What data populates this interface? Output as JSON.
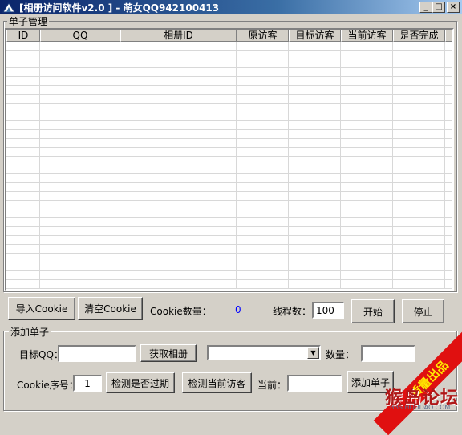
{
  "window": {
    "title": "[相册访问软件v2.0 ] - 萌女QQ942100413",
    "minimize": "_",
    "maximize": "□",
    "close": "×"
  },
  "orders": {
    "group_label": "单子管理",
    "columns": [
      "ID",
      "QQ",
      "相册ID",
      "原访客",
      "目标访客",
      "当前访客",
      "是否完成"
    ]
  },
  "controls": {
    "import_cookie": "导入Cookie",
    "clear_cookie": "清空Cookie",
    "cookie_count_label": "Cookie数量：",
    "cookie_count_value": "0",
    "threads_label": "线程数：",
    "threads_value": "100",
    "start": "开始",
    "stop": "停止"
  },
  "add_order": {
    "group_label": "添加单子",
    "target_qq_label": "目标QQ：",
    "target_qq_value": "",
    "get_album": "获取相册",
    "album_select_value": "",
    "quantity_label": "数量：",
    "quantity_value": "",
    "cookie_index_label": "Cookie序号：",
    "cookie_index_value": "1",
    "check_expired": "检测是否过期",
    "check_visitors": "检测当前访客",
    "current_label": "当前：",
    "current_value": "",
    "add_order_button": "添加单子"
  },
  "watermark": {
    "band": "质量出品",
    "logo": "猴岛论坛",
    "url": "BBS.HOUDAO.COM"
  }
}
